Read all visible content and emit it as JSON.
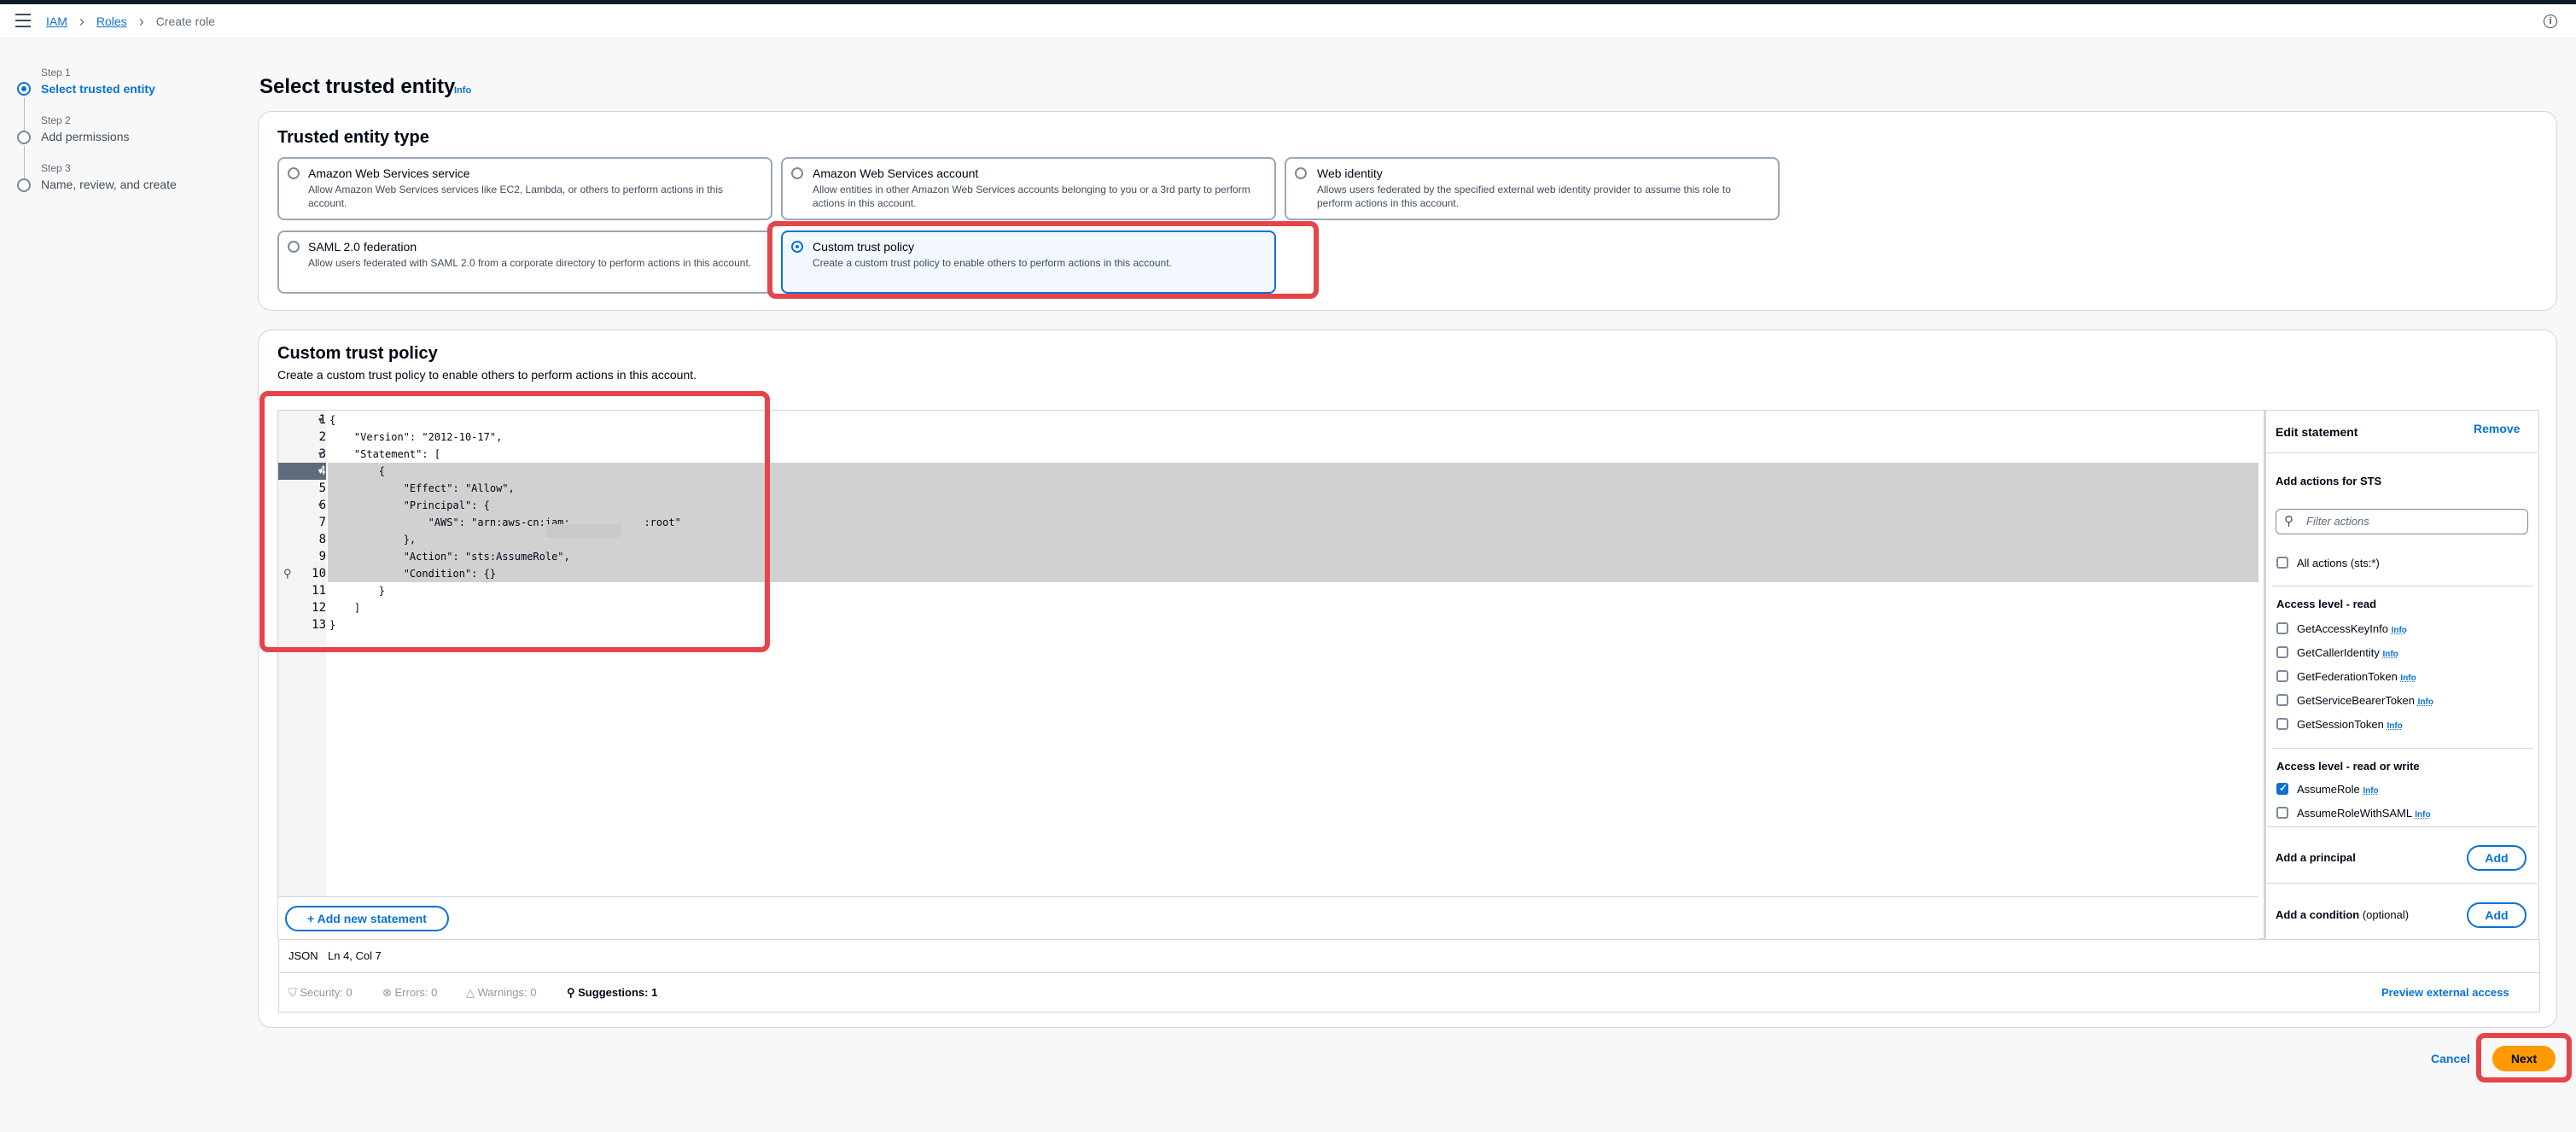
{
  "breadcrumb": {
    "iam": "IAM",
    "roles": "Roles",
    "current": "Create role"
  },
  "steps": [
    {
      "label": "Step 1",
      "title": "Select trusted entity"
    },
    {
      "label": "Step 2",
      "title": "Add permissions"
    },
    {
      "label": "Step 3",
      "title": "Name, review, and create"
    }
  ],
  "page": {
    "title": "Select trusted entity",
    "info": "Info"
  },
  "entity_type": {
    "title": "Trusted entity type",
    "options": [
      {
        "title": "Amazon Web Services service",
        "desc": "Allow Amazon Web Services services like EC2, Lambda, or others to perform actions in this account."
      },
      {
        "title": "Amazon Web Services account",
        "desc": "Allow entities in other Amazon Web Services accounts belonging to you or a 3rd party to perform actions in this account."
      },
      {
        "title": "Web identity",
        "desc": "Allows users federated by the specified external web identity provider to assume this role to perform actions in this account."
      },
      {
        "title": "SAML 2.0 federation",
        "desc": "Allow users federated with SAML 2.0 from a corporate directory to perform actions in this account."
      },
      {
        "title": "Custom trust policy",
        "desc": "Create a custom trust policy to enable others to perform actions in this account."
      }
    ],
    "selected": "Custom trust policy"
  },
  "custom_policy": {
    "title": "Custom trust policy",
    "desc": "Create a custom trust policy to enable others to perform actions in this account.",
    "line_numbers": [
      "1",
      "2",
      "3",
      "4",
      "5",
      "6",
      "7",
      "8",
      "9",
      "10",
      "11",
      "12",
      "13"
    ],
    "code_lines": [
      "{",
      "    \"Version\": \"2012-10-17\",",
      "    \"Statement\": [",
      "        {",
      "            \"Effect\": \"Allow\",",
      "            \"Principal\": {",
      "                \"AWS\": \"arn:aws-cn:iam:            :root\"",
      "            },",
      "            \"Action\": \"sts:AssumeRole\",",
      "            \"Condition\": {}",
      "        }",
      "    ]",
      "}"
    ],
    "add_statement": "Add new statement",
    "status": {
      "format": "JSON",
      "position": "Ln 4, Col 7"
    },
    "validation": {
      "security": "Security: 0",
      "errors": "Errors: 0",
      "warnings": "Warnings: 0",
      "suggestions": "Suggestions: 1"
    },
    "preview": "Preview external access"
  },
  "statement_panel": {
    "title": "Edit statement",
    "remove": "Remove",
    "add_actions": "Add actions for STS",
    "filter_placeholder": "Filter actions",
    "all_actions": "All actions (sts:*)",
    "read_header": "Access level - read",
    "read_items": [
      "GetAccessKeyInfo",
      "GetCallerIdentity",
      "GetFederationToken",
      "GetServiceBearerToken",
      "GetSessionToken"
    ],
    "rw_header": "Access level - read or write",
    "rw_items": [
      "AssumeRole",
      "AssumeRoleWithSAML"
    ],
    "info": "Info",
    "add_principal": "Add a principal",
    "add_condition": "Add a condition",
    "optional": "(optional)",
    "add": "Add"
  },
  "footer": {
    "cancel": "Cancel",
    "next": "Next"
  }
}
